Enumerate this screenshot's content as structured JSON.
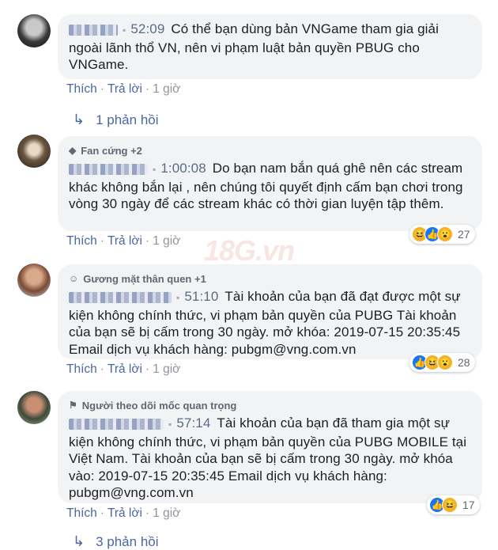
{
  "watermark": "18G.vn",
  "comments": [
    {
      "timestamp": "52:09",
      "text": "Có thể bạn dùng bản VNGame tham gia giải ngoài lãnh thổ VN, nên vi phạm luật bản quyền PBUG cho VNGame.",
      "actions": {
        "like": "Thích",
        "reply": "Trả lời",
        "time": "1 giờ"
      },
      "replies": "1 phản hồi"
    },
    {
      "badge": "Fan cứng +2",
      "timestamp": "1:00:08",
      "text": "Do bạn nam bắn quá ghê nên các stream khác không bắn lại , nên chúng tôi quyết định cấm bạn chơi trong vòng 30 ngày để các stream khác có thời gian luyện tập thêm.",
      "actions": {
        "like": "Thích",
        "reply": "Trả lời",
        "time": "1 giờ"
      },
      "reaction_count": "27"
    },
    {
      "badge": "Gương mặt thân quen +1",
      "timestamp": "51:10",
      "text": "Tài khoản của bạn đã đạt được một sự kiện không chính thức, vi phạm bản quyền của PUBG Tài khoản của bạn sẽ bị cấm trong 30 ngày. mở khóa: 2019-07-15 20:35:45 Email dịch vụ khách hàng: pubgm@vng.com.vn",
      "actions": {
        "like": "Thích",
        "reply": "Trả lời",
        "time": "1 giờ"
      },
      "reaction_count": "28"
    },
    {
      "badge": "Người theo dõi mốc quan trọng",
      "timestamp": "57:14",
      "text": "Tài khoản của bạn đã tham gia một sự kiện không chính thức, vi phạm bản quyền của PUBG MOBILE tại Việt Nam. Tài khoản của bạn sẽ bị cấm trong 30 ngày. mở khóa vào: 2019-07-15 20:35:45 Email dịch vụ khách hàng: pubgm@vng.com.vn",
      "actions": {
        "like": "Thích",
        "reply": "Trả lời",
        "time": "1 giờ"
      },
      "reaction_count": "17",
      "replies": "3 phản hồi"
    }
  ]
}
